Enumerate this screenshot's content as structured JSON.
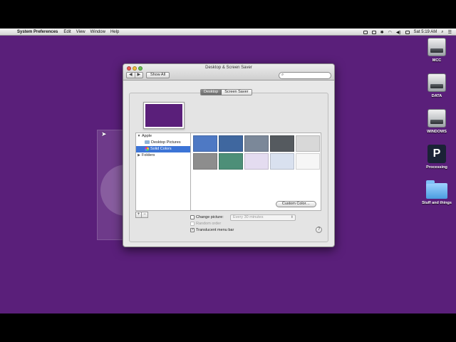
{
  "menubar": {
    "app_name": "System Preferences",
    "items": [
      "Edit",
      "View",
      "Window",
      "Help"
    ],
    "clock": "Sat 5:19 AM",
    "apple_glyph": "",
    "search_glyph": "⌕",
    "list_glyph": "☰"
  },
  "desktop_icons": [
    {
      "label": "MCC",
      "kind": "drive-icon"
    },
    {
      "label": "DATA",
      "kind": "drive-icon"
    },
    {
      "label": "WINDOWS",
      "kind": "drive-icon"
    },
    {
      "label": "Processing",
      "kind": "processing-app-icon",
      "glyph": "P"
    },
    {
      "label": "Stuff and things",
      "kind": "folder-icon"
    }
  ],
  "window": {
    "title": "Desktop & Screen Saver",
    "show_all_label": "Show All",
    "nav_back": "◀",
    "nav_forward": "▶",
    "search_glyph": "⌕",
    "search_placeholder": "",
    "tabs": [
      "Desktop",
      "Screen Saver"
    ],
    "sources": {
      "group_apple": "Apple",
      "desktop_pictures": "Desktop Pictures",
      "solid_colors": "Solid Colors",
      "group_folders": "Folders",
      "expanded_glyph": "▼",
      "collapsed_glyph": "▶"
    },
    "add_label": "+",
    "remove_label": "−",
    "swatches": [
      "#4e79c4",
      "#3f679f",
      "#7b8899",
      "#555a5f",
      "#d8d8d8",
      "#8d8d8d",
      "#4d8f78",
      "#e4dcf0",
      "#d9e1ef",
      "#f6f6f6"
    ],
    "custom_color_label": "Custom Color…",
    "change_picture_label": "Change picture:",
    "interval_value": "Every 30 minutes",
    "interval_arrows": "⬍",
    "random_order_label": "Random order",
    "translucent_label": "Translucent menu bar",
    "check_glyph": "✓",
    "help_label": "?"
  },
  "colors": {
    "desktop": "#5a1f7a",
    "selection": "#3c74d6"
  }
}
